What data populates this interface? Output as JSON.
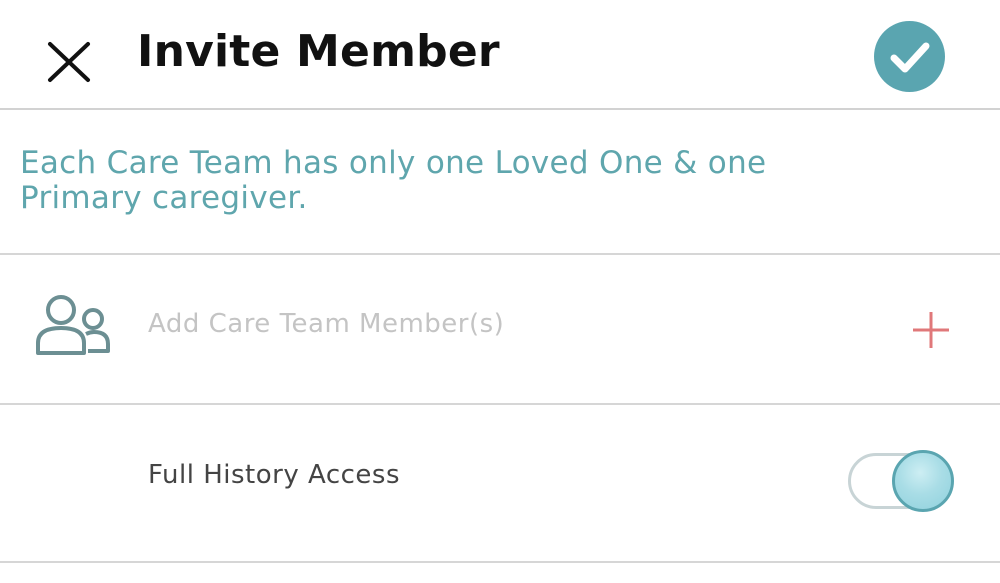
{
  "header": {
    "title": "Invite Member",
    "close_icon": "close-icon",
    "confirm_icon": "checkmark-icon"
  },
  "info": {
    "message": "Each Care Team has only one Loved One & one Primary caregiver."
  },
  "members": {
    "placeholder": "Add Care Team Member(s)",
    "people_icon": "people-icon",
    "add_icon": "plus-icon"
  },
  "access": {
    "label": "Full History Access",
    "enabled": true
  },
  "colors": {
    "accent": "#5aa5b0",
    "info_text": "#5fa6ad",
    "plus": "#e0787a",
    "placeholder": "#c4c4c4",
    "people_icon": "#6c8f93"
  }
}
